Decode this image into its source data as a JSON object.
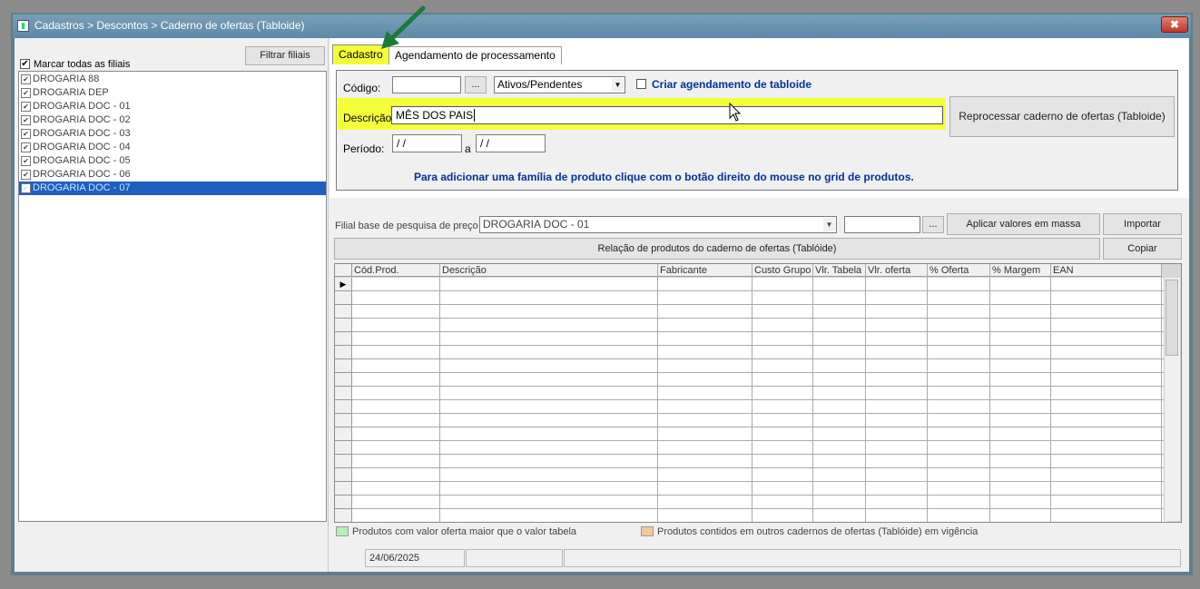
{
  "window": {
    "title": "Cadastros > Descontos > Caderno de ofertas (Tabloide)",
    "close_glyph": "✖"
  },
  "left": {
    "filter_button": "Filtrar filiais",
    "select_all_label": "Marcar todas as filiais",
    "branches": [
      {
        "label": "DROGARIA 88",
        "checked": true,
        "selected": false
      },
      {
        "label": "DROGARIA DEP",
        "checked": true,
        "selected": false
      },
      {
        "label": "DROGARIA DOC - 01",
        "checked": true,
        "selected": false
      },
      {
        "label": "DROGARIA DOC - 02",
        "checked": true,
        "selected": false
      },
      {
        "label": "DROGARIA DOC - 03",
        "checked": true,
        "selected": false
      },
      {
        "label": "DROGARIA DOC - 04",
        "checked": true,
        "selected": false
      },
      {
        "label": "DROGARIA DOC - 05",
        "checked": true,
        "selected": false
      },
      {
        "label": "DROGARIA DOC - 06",
        "checked": true,
        "selected": false
      },
      {
        "label": "DROGARIA DOC - 07",
        "checked": true,
        "selected": true
      }
    ]
  },
  "tabs": [
    {
      "label": "Cadastro",
      "active": true
    },
    {
      "label": "Agendamento de processamento",
      "active": false
    }
  ],
  "form": {
    "codigo_label": "Código:",
    "codigo_value": "",
    "ellipsis": "...",
    "status_select": "Ativos/Pendentes",
    "schedule_checkbox_label": "Criar agendamento de tabloide",
    "descricao_label": "Descrição:",
    "descricao_value": "MÊS DOS PAIS",
    "reprocess_button": "Reprocessar caderno de ofertas (Tabloide)",
    "periodo_label": "Período:",
    "periodo_start": " / /",
    "periodo_sep": "a",
    "periodo_end": " / /",
    "hint": "Para adicionar uma família de produto clique com o botão direito do  mouse no grid de produtos."
  },
  "pricing": {
    "base_label": "Filial base de pesquisa de preço",
    "base_value": "DROGARIA DOC - 01",
    "extra_value": "",
    "ellipsis": "...",
    "apply_button": "Aplicar valores em massa",
    "import_button": "Importar",
    "relation_button": "Relação de produtos do caderno de ofertas (Tablóide)",
    "copy_button": "Copiar"
  },
  "grid": {
    "columns": [
      "Cód.Prod.",
      "Descrição",
      "Fabricante",
      "Custo Grupo",
      "Vlr. Tabela",
      "Vlr. oferta",
      "% Oferta",
      "% Margem",
      "EAN"
    ],
    "row_count": 18,
    "current_row_marker": "▶"
  },
  "legend": {
    "green_label": "Produtos com valor oferta maior que o valor tabela",
    "green_color": "#b5f0b5",
    "orange_label": "Produtos contidos em outros cadernos de ofertas (Tablóide) em vigência",
    "orange_color": "#f5c89a"
  },
  "status": {
    "date": "24/06/2025"
  },
  "colors": {
    "highlight": "#f4ff3a",
    "hint_blue": "#003399",
    "selection": "#1f5fbf",
    "arrow_green": "#1a7a3a"
  }
}
